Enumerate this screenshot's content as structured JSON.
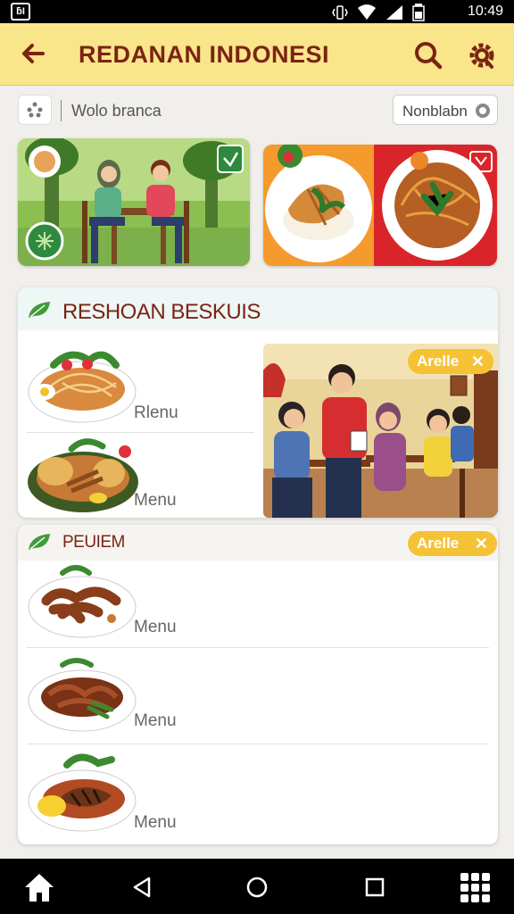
{
  "status_bar": {
    "time": "10:49",
    "logo_text": "ƃI"
  },
  "app_bar": {
    "title": "REDANAN INDONESI",
    "back_icon": "arrow-left-icon",
    "search_icon": "search-icon",
    "settings_icon": "gear-icon"
  },
  "filter_row": {
    "label": "Wolo branca",
    "toggle_label": "Nonblabn"
  },
  "section_recommend": {
    "title": "RESHOAN BESKUIS",
    "items": [
      {
        "label": "Rlenu"
      },
      {
        "label": "Menu"
      }
    ],
    "chip": "Arelle"
  },
  "section_review": {
    "title": "PEUIEM",
    "chip": "Arelle",
    "items": [
      {
        "label": "Menu"
      },
      {
        "label": "Menu"
      },
      {
        "label": "Menu"
      }
    ]
  },
  "colors": {
    "app_bar": "#f9e58a",
    "title": "#7a2413",
    "chip": "#f5c236",
    "accent_green": "#3e9b3a"
  }
}
